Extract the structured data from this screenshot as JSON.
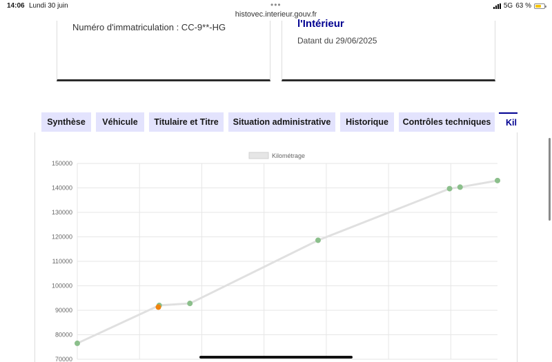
{
  "status_bar": {
    "time": "14:06",
    "date": "Lundi 30 juin",
    "url": "histovec.interieur.gouv.fr",
    "network": "5G",
    "battery": "63 %",
    "battery_level": 0.63
  },
  "cards": {
    "left": {
      "plate": "Numéro d'immatriculation : CC-9**-HG"
    },
    "right": {
      "ministry": "l'Intérieur",
      "date": "Datant du 29/06/2025"
    }
  },
  "tabs": [
    {
      "label": "Synthèse"
    },
    {
      "label": "Véhicule"
    },
    {
      "label": "Titulaire et Titre"
    },
    {
      "label": "Situation administrative"
    },
    {
      "label": "Historique"
    },
    {
      "label": "Contrôles techniques"
    },
    {
      "label": "Kil"
    }
  ],
  "colors": {
    "accent": "#000091",
    "tab_bg": "#e3e3fd",
    "series_line": "#e0e0e0",
    "point_green": "#8bbf8b",
    "point_orange": "#f0840e"
  },
  "chart_data": {
    "type": "line",
    "legend": "Kilométrage",
    "y_ticks": [
      "150000",
      "140000",
      "130000",
      "120000",
      "110000",
      "100000",
      "90000",
      "80000",
      "70000"
    ],
    "ylim": [
      70000,
      150000
    ],
    "grid": true,
    "legend_position": "top-center",
    "series": [
      {
        "name": "Kilométrage",
        "points": [
          {
            "x": 0.0,
            "y": 76500,
            "status": "green"
          },
          {
            "x": 0.195,
            "y": 92000,
            "status": "green"
          },
          {
            "x": 0.193,
            "y": 91300,
            "status": "orange"
          },
          {
            "x": 0.268,
            "y": 92800,
            "status": "green"
          },
          {
            "x": 0.573,
            "y": 118600,
            "status": "green"
          },
          {
            "x": 0.886,
            "y": 139700,
            "status": "green"
          },
          {
            "x": 0.911,
            "y": 140300,
            "status": "green"
          },
          {
            "x": 1.0,
            "y": 143000,
            "status": "green"
          }
        ]
      }
    ]
  }
}
